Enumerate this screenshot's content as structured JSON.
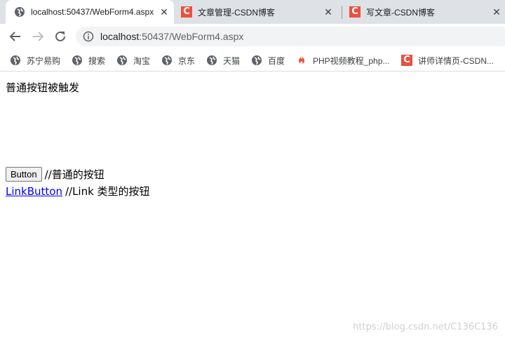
{
  "tabs": [
    {
      "title": "localhost:50437/WebForm4.aspx",
      "active": true,
      "icon": "globe-icon"
    },
    {
      "title": "文章管理-CSDN博客",
      "active": false,
      "icon": "csdn-icon"
    },
    {
      "title": "写文章-CSDN博客",
      "active": false,
      "icon": "csdn-icon"
    }
  ],
  "tab_close_glyph": "✕",
  "csdn_letter": "C",
  "address": {
    "host": "localhost",
    "rest": ":50437/WebForm4.aspx"
  },
  "bookmarks": [
    {
      "label": "苏宁易购",
      "icon": "globe-icon"
    },
    {
      "label": "搜索",
      "icon": "globe-icon"
    },
    {
      "label": "淘宝",
      "icon": "globe-icon"
    },
    {
      "label": "京东",
      "icon": "globe-icon"
    },
    {
      "label": "天猫",
      "icon": "globe-icon"
    },
    {
      "label": "百度",
      "icon": "globe-icon"
    },
    {
      "label": "PHP视频教程_php...",
      "icon": "flame-icon"
    },
    {
      "label": "讲师详情页-CSDN...",
      "icon": "csdn-icon"
    }
  ],
  "page": {
    "status_text": "普通按钮被触发",
    "button_label": "Button",
    "button_comment": "//普通的按钮",
    "link_label": "LinkButton",
    "link_comment": "//Link 类型的按钮",
    "watermark": "https://blog.csdn.net/C136C136"
  },
  "colors": {
    "tabstrip_bg": "#dee1e6",
    "csdn_red": "#e9513f",
    "link_blue": "#0000ee"
  }
}
